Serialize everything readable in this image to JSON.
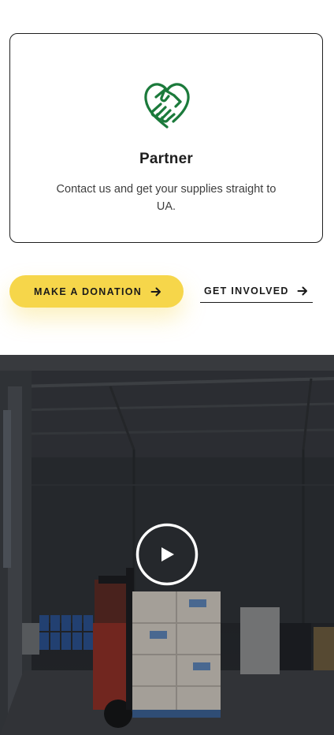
{
  "card": {
    "icon": "handshake-heart-icon",
    "title": "Partner",
    "description": "Contact us and get your supplies straight to UA."
  },
  "actions": {
    "donate_label": "MAKE A DONATION",
    "involved_label": "GET INVOLVED",
    "arrow_icon": "arrow-right-icon"
  },
  "video": {
    "play_icon": "play-icon",
    "scene": "warehouse-forklift"
  },
  "colors": {
    "accent": "#f6d64a",
    "icon_green": "#1b7a3b",
    "border": "#1f1f1f"
  }
}
